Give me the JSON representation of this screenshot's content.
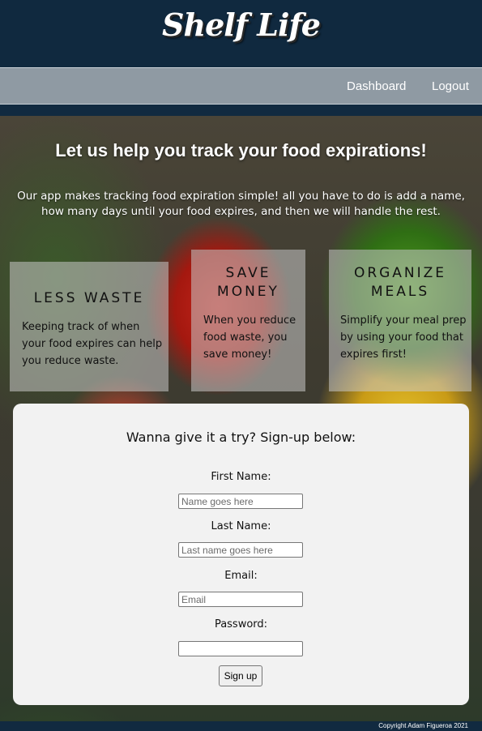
{
  "header": {
    "logo": "Shelf Life"
  },
  "nav": {
    "dashboard": "Dashboard",
    "logout": "Logout"
  },
  "hero": {
    "title": "Let us help you track your food expirations!",
    "description": "Our app makes tracking food expiration simple! all you have to do is add a name, how many days until your food expires, and then we will handle the rest."
  },
  "features": [
    {
      "title": "LESS WASTE",
      "body": "Keeping track of when your food expires can help you reduce waste."
    },
    {
      "title": "SAVE MONEY",
      "body": "When you reduce food waste, you save money!"
    },
    {
      "title": "ORGANIZE MEALS",
      "body": "Simplify your meal prep by using your food that expires first!"
    }
  ],
  "signup": {
    "title": "Wanna give it a try? Sign-up below:",
    "first_name_label": "First Name:",
    "first_name_placeholder": "Name goes here",
    "last_name_label": "Last Name:",
    "last_name_placeholder": "Last name goes here",
    "email_label": "Email:",
    "email_placeholder": "Email",
    "password_label": "Password:",
    "button": "Sign up"
  },
  "footer": {
    "copyright": "Copyright Adam Figueroa 2021"
  },
  "colors": {
    "header_bg": "#10293f",
    "nav_bg": "#8f9aa3",
    "card_bg": "#f2f2f2"
  }
}
